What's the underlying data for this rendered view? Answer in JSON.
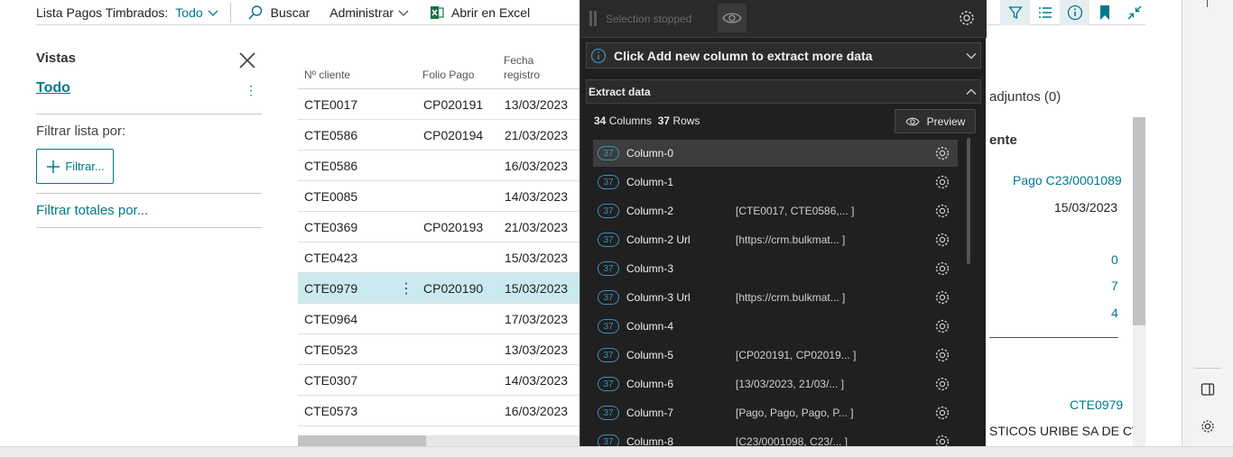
{
  "toolbar": {
    "title": "Lista Pagos Timbrados:",
    "view_selector": "Todo",
    "search": "Buscar",
    "manage": "Administrar",
    "excel": "Abrir en Excel"
  },
  "views": {
    "title": "Vistas",
    "selected": "Todo",
    "filter_label": "Filtrar lista por:",
    "filter_button": "Filtrar...",
    "filter_totals": "Filtrar totales por..."
  },
  "table": {
    "headers": [
      "Nº cliente",
      "Folio Pago",
      "Fecha",
      "registro"
    ],
    "rows": [
      {
        "cliente": "CTE0017",
        "folio": "CP020191",
        "fecha": "13/03/2023"
      },
      {
        "cliente": "CTE0586",
        "folio": "CP020194",
        "fecha": "21/03/2023"
      },
      {
        "cliente": "CTE0586",
        "folio": "",
        "fecha": "16/03/2023"
      },
      {
        "cliente": "CTE0085",
        "folio": "",
        "fecha": "14/03/2023"
      },
      {
        "cliente": "CTE0369",
        "folio": "CP020193",
        "fecha": "21/03/2023"
      },
      {
        "cliente": "CTE0423",
        "folio": "",
        "fecha": "15/03/2023"
      },
      {
        "cliente": "CTE0979",
        "folio": "CP020190",
        "fecha": "15/03/2023",
        "selected": true
      },
      {
        "cliente": "CTE0964",
        "folio": "",
        "fecha": "17/03/2023"
      },
      {
        "cliente": "CTE0523",
        "folio": "",
        "fecha": "13/03/2023"
      },
      {
        "cliente": "CTE0307",
        "folio": "",
        "fecha": "14/03/2023"
      },
      {
        "cliente": "CTE0573",
        "folio": "",
        "fecha": "16/03/2023"
      }
    ]
  },
  "detail": {
    "attachments": "adjuntos (0)",
    "heading": "ente",
    "payment": "Pago C23/0001089",
    "date": "15/03/2023",
    "n0": "0",
    "n1": "7",
    "n2": "4",
    "customer": "CTE0979",
    "customer_name": "STICOS URIBE SA DE CV"
  },
  "overlay": {
    "status": "Selection stopped",
    "banner": "Click Add new column to extract more data",
    "extract_title": "Extract data",
    "columns_count": "34",
    "columns_label": "Columns",
    "rows_count": "37",
    "rows_label": "Rows",
    "preview": "Preview",
    "columns": [
      {
        "count": "37",
        "name": "Column-0",
        "preview": ""
      },
      {
        "count": "37",
        "name": "Column-1",
        "preview": ""
      },
      {
        "count": "37",
        "name": "Column-2",
        "preview": "[CTE0017, CTE0586,... ]"
      },
      {
        "count": "37",
        "name": "Column-2 Url",
        "preview": "[https://crm.bulkmat... ]"
      },
      {
        "count": "37",
        "name": "Column-3",
        "preview": ""
      },
      {
        "count": "37",
        "name": "Column-3 Url",
        "preview": "[https://crm.bulkmat... ]"
      },
      {
        "count": "37",
        "name": "Column-4",
        "preview": ""
      },
      {
        "count": "37",
        "name": "Column-5",
        "preview": "[CP020191, CP02019... ]"
      },
      {
        "count": "37",
        "name": "Column-6",
        "preview": "[13/03/2023, 21/03/... ]"
      },
      {
        "count": "37",
        "name": "Column-7",
        "preview": "[Pago, Pago, Pago, P... ]"
      },
      {
        "count": "37",
        "name": "Column-8",
        "preview": "[C23/0001098, C23/... ]"
      }
    ]
  },
  "colors": {
    "accent": "#00788a",
    "selected_row": "#cbeaef",
    "overlay_bg": "#202020",
    "badge": "#3a8fbd"
  }
}
